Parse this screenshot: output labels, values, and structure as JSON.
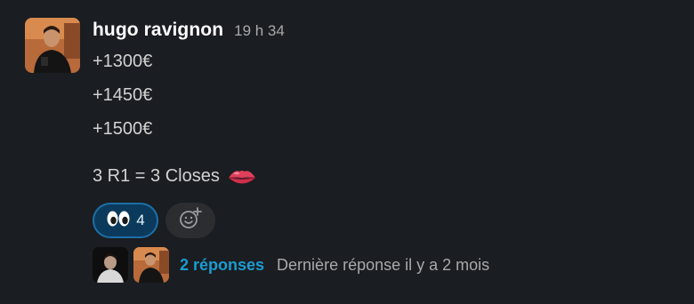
{
  "message": {
    "author": "hugo ravignon",
    "timestamp": "19 h 34",
    "lines": [
      "+1300€",
      "+1450€",
      "+1500€"
    ],
    "closing_line": "3 R1 = 3 Closes",
    "closing_emoji": "lips-icon"
  },
  "reactions": [
    {
      "emoji": "eyes-icon",
      "count": "4",
      "active": true
    }
  ],
  "add_reaction": {
    "icon": "add-emoji-icon"
  },
  "thread": {
    "replies_label": "2 réponses",
    "last_reply_label": "Dernière réponse il y a 2 mois"
  },
  "colors": {
    "background": "#1a1d21",
    "link": "#1d9bd1",
    "reaction_active_bg": "#0b3a5c",
    "reaction_active_border": "#1d6fa8"
  }
}
